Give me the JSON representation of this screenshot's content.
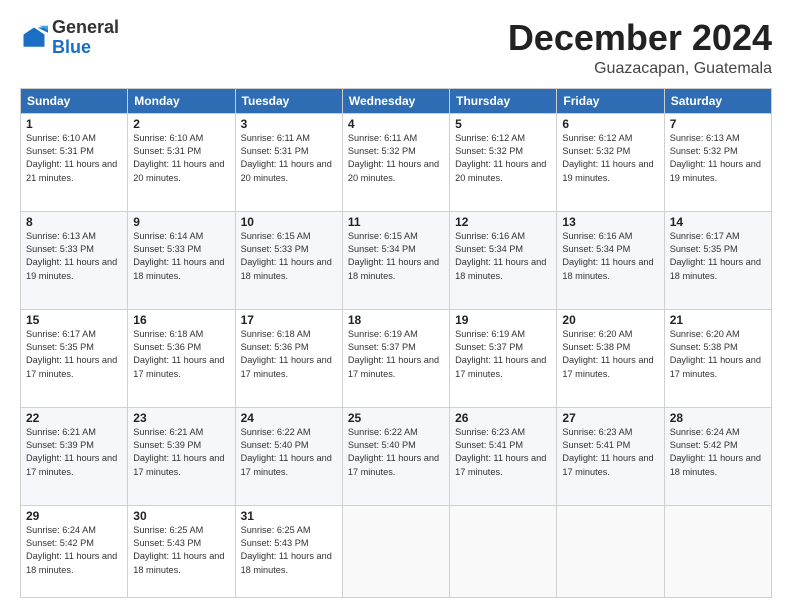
{
  "logo": {
    "general": "General",
    "blue": "Blue"
  },
  "header": {
    "month_title": "December 2024",
    "subtitle": "Guazacapan, Guatemala"
  },
  "weekdays": [
    "Sunday",
    "Monday",
    "Tuesday",
    "Wednesday",
    "Thursday",
    "Friday",
    "Saturday"
  ],
  "weeks": [
    [
      {
        "day": 1,
        "sunrise": "6:10 AM",
        "sunset": "5:31 PM",
        "daylight": "11 hours and 21 minutes."
      },
      {
        "day": 2,
        "sunrise": "6:10 AM",
        "sunset": "5:31 PM",
        "daylight": "11 hours and 20 minutes."
      },
      {
        "day": 3,
        "sunrise": "6:11 AM",
        "sunset": "5:31 PM",
        "daylight": "11 hours and 20 minutes."
      },
      {
        "day": 4,
        "sunrise": "6:11 AM",
        "sunset": "5:32 PM",
        "daylight": "11 hours and 20 minutes."
      },
      {
        "day": 5,
        "sunrise": "6:12 AM",
        "sunset": "5:32 PM",
        "daylight": "11 hours and 20 minutes."
      },
      {
        "day": 6,
        "sunrise": "6:12 AM",
        "sunset": "5:32 PM",
        "daylight": "11 hours and 19 minutes."
      },
      {
        "day": 7,
        "sunrise": "6:13 AM",
        "sunset": "5:32 PM",
        "daylight": "11 hours and 19 minutes."
      }
    ],
    [
      {
        "day": 8,
        "sunrise": "6:13 AM",
        "sunset": "5:33 PM",
        "daylight": "11 hours and 19 minutes."
      },
      {
        "day": 9,
        "sunrise": "6:14 AM",
        "sunset": "5:33 PM",
        "daylight": "11 hours and 18 minutes."
      },
      {
        "day": 10,
        "sunrise": "6:15 AM",
        "sunset": "5:33 PM",
        "daylight": "11 hours and 18 minutes."
      },
      {
        "day": 11,
        "sunrise": "6:15 AM",
        "sunset": "5:34 PM",
        "daylight": "11 hours and 18 minutes."
      },
      {
        "day": 12,
        "sunrise": "6:16 AM",
        "sunset": "5:34 PM",
        "daylight": "11 hours and 18 minutes."
      },
      {
        "day": 13,
        "sunrise": "6:16 AM",
        "sunset": "5:34 PM",
        "daylight": "11 hours and 18 minutes."
      },
      {
        "day": 14,
        "sunrise": "6:17 AM",
        "sunset": "5:35 PM",
        "daylight": "11 hours and 18 minutes."
      }
    ],
    [
      {
        "day": 15,
        "sunrise": "6:17 AM",
        "sunset": "5:35 PM",
        "daylight": "11 hours and 17 minutes."
      },
      {
        "day": 16,
        "sunrise": "6:18 AM",
        "sunset": "5:36 PM",
        "daylight": "11 hours and 17 minutes."
      },
      {
        "day": 17,
        "sunrise": "6:18 AM",
        "sunset": "5:36 PM",
        "daylight": "11 hours and 17 minutes."
      },
      {
        "day": 18,
        "sunrise": "6:19 AM",
        "sunset": "5:37 PM",
        "daylight": "11 hours and 17 minutes."
      },
      {
        "day": 19,
        "sunrise": "6:19 AM",
        "sunset": "5:37 PM",
        "daylight": "11 hours and 17 minutes."
      },
      {
        "day": 20,
        "sunrise": "6:20 AM",
        "sunset": "5:38 PM",
        "daylight": "11 hours and 17 minutes."
      },
      {
        "day": 21,
        "sunrise": "6:20 AM",
        "sunset": "5:38 PM",
        "daylight": "11 hours and 17 minutes."
      }
    ],
    [
      {
        "day": 22,
        "sunrise": "6:21 AM",
        "sunset": "5:39 PM",
        "daylight": "11 hours and 17 minutes."
      },
      {
        "day": 23,
        "sunrise": "6:21 AM",
        "sunset": "5:39 PM",
        "daylight": "11 hours and 17 minutes."
      },
      {
        "day": 24,
        "sunrise": "6:22 AM",
        "sunset": "5:40 PM",
        "daylight": "11 hours and 17 minutes."
      },
      {
        "day": 25,
        "sunrise": "6:22 AM",
        "sunset": "5:40 PM",
        "daylight": "11 hours and 17 minutes."
      },
      {
        "day": 26,
        "sunrise": "6:23 AM",
        "sunset": "5:41 PM",
        "daylight": "11 hours and 17 minutes."
      },
      {
        "day": 27,
        "sunrise": "6:23 AM",
        "sunset": "5:41 PM",
        "daylight": "11 hours and 17 minutes."
      },
      {
        "day": 28,
        "sunrise": "6:24 AM",
        "sunset": "5:42 PM",
        "daylight": "11 hours and 18 minutes."
      }
    ],
    [
      {
        "day": 29,
        "sunrise": "6:24 AM",
        "sunset": "5:42 PM",
        "daylight": "11 hours and 18 minutes."
      },
      {
        "day": 30,
        "sunrise": "6:25 AM",
        "sunset": "5:43 PM",
        "daylight": "11 hours and 18 minutes."
      },
      {
        "day": 31,
        "sunrise": "6:25 AM",
        "sunset": "5:43 PM",
        "daylight": "11 hours and 18 minutes."
      },
      null,
      null,
      null,
      null
    ]
  ]
}
